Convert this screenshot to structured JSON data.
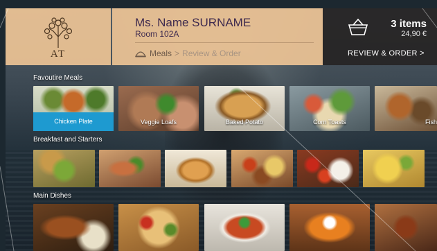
{
  "header": {
    "logo_text": "AT",
    "guest": {
      "name": "Ms. Name SURNAME",
      "room": "Room 102A"
    },
    "breadcrumb": {
      "icon": "cloche-icon",
      "current": "Meals",
      "separator": ">",
      "next": "Review & Order"
    },
    "cart": {
      "icon": "basket-icon",
      "count": "3 items",
      "total": "24,90 €",
      "review_label": "REVIEW & ORDER >"
    }
  },
  "colors": {
    "header_panel": "#ecc394",
    "cart_panel": "#262424",
    "selected_tile": "#1e9ad0",
    "guest_text": "#3e2a4e"
  },
  "sections": [
    {
      "title": "Favoutire Meals",
      "items": [
        {
          "label": "Chicken Plate",
          "selected": true
        },
        {
          "label": "Veggie Loafs"
        },
        {
          "label": "Baked Potato"
        },
        {
          "label": "Corn Toasts"
        },
        {
          "label": "Fish Plat"
        }
      ]
    },
    {
      "title": "Breakfast and Starters",
      "items": [
        {},
        {},
        {},
        {},
        {},
        {}
      ]
    },
    {
      "title": "Main Dishes",
      "items": [
        {},
        {},
        {},
        {},
        {}
      ]
    }
  ]
}
